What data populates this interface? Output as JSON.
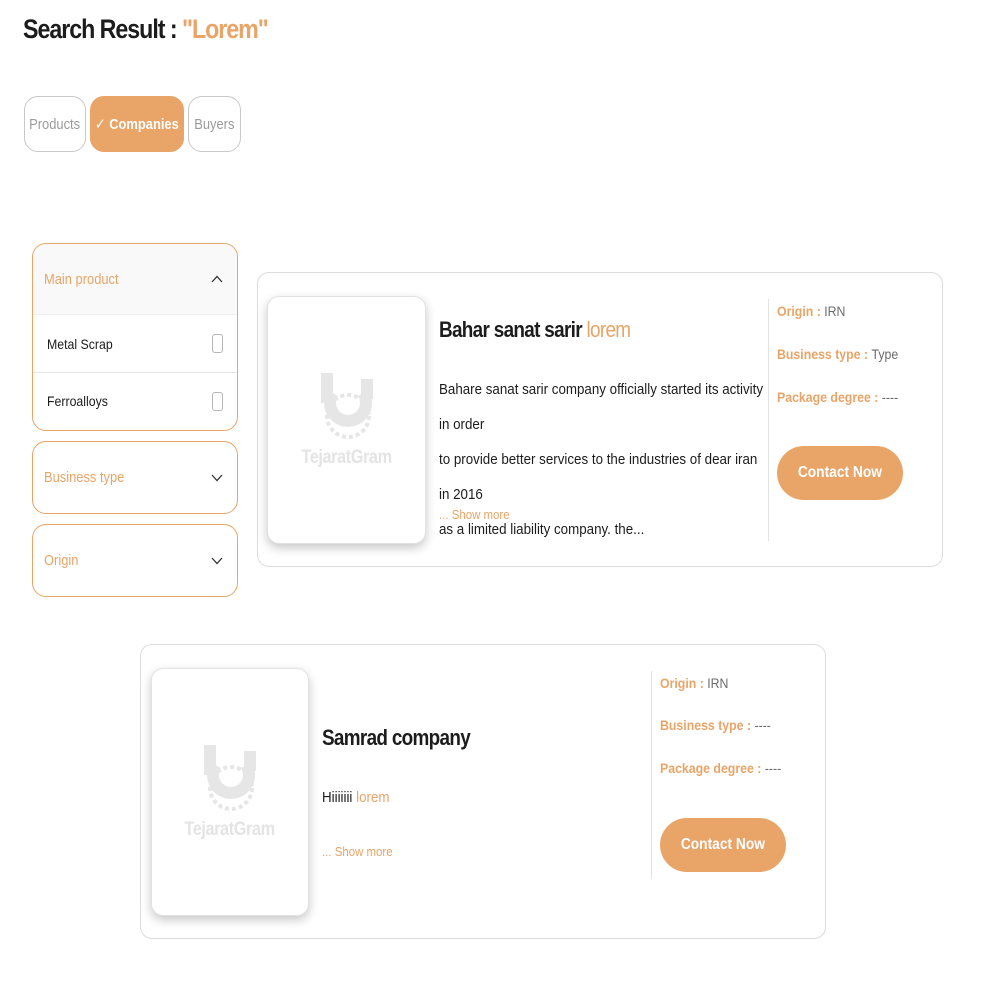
{
  "header": {
    "title_prefix": "Search Result : ",
    "query": "\"Lorem\""
  },
  "tabs": [
    {
      "label": "Products",
      "active": false
    },
    {
      "label": "✓ Companies",
      "active": true
    },
    {
      "label": "Buyers",
      "active": false
    }
  ],
  "filters": {
    "main_product": {
      "label": "Main product",
      "expanded": true,
      "options": [
        {
          "label": "Metal Scrap",
          "checked": false
        },
        {
          "label": "Ferroalloys",
          "checked": false
        }
      ]
    },
    "business_type": {
      "label": "Business type",
      "expanded": false
    },
    "origin": {
      "label": "Origin",
      "expanded": false
    }
  },
  "results": [
    {
      "name": "Bahar sanat sarir ",
      "name_highlight": "lorem",
      "description_lines": [
        "Bahare sanat sarir company officially started its activity in order",
        "to provide better services to the industries of dear iran in 2016",
        "as a limited liability company. the..."
      ],
      "description_plain": "",
      "description_highlight": "",
      "show_more": "... Show more",
      "logo_text": "TejaratGram",
      "origin_label": "Origin : ",
      "origin_value": "IRN",
      "business_type_label": "Business type : ",
      "business_type_value": "Type",
      "package_degree_label": "Package degree : ",
      "package_degree_value": "----",
      "contact_label": "Contact Now"
    },
    {
      "name": "Samrad company",
      "name_highlight": "",
      "description_lines": [],
      "description_plain": "Hiiiiiii ",
      "description_highlight": "lorem",
      "show_more": "... Show more",
      "logo_text": "TejaratGram",
      "origin_label": "Origin : ",
      "origin_value": "IRN",
      "business_type_label": "Business type : ",
      "business_type_value": "----",
      "package_degree_label": "Package degree : ",
      "package_degree_value": "----",
      "contact_label": "Contact Now"
    }
  ],
  "colors": {
    "accent": "#e9a468",
    "border": "#dcdcdc",
    "text": "#1c1c1c",
    "muted": "#9a9a9a"
  },
  "icons": {
    "chevron_up": "chevron-up-icon",
    "chevron_down": "chevron-down-icon",
    "logo": "tejaratgram-logo"
  }
}
